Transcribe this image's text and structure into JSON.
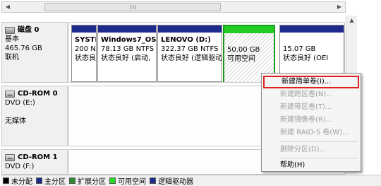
{
  "disks": [
    {
      "name": "磁盘 0",
      "type": "基本",
      "size": "465.76 GB",
      "status": "联机",
      "partitions": [
        {
          "title": "SYSTI",
          "size": "200 N",
          "status": "状态良好"
        },
        {
          "title": "Windows7_OS",
          "size": "78.13 GB NTFS",
          "status": "状态良好 (启动,"
        },
        {
          "title": "LENOVO  (D:)",
          "size": "322.37 GB NTFS",
          "status": "状态良好 (逻辑驱动"
        },
        {
          "title": "",
          "size": "50.00 GB",
          "status": "可用空间"
        },
        {
          "title": "",
          "size": "15.07 GB",
          "status": "状态良好 (OEI"
        }
      ]
    },
    {
      "name": "CD-ROM 0",
      "type": "DVD (E:)",
      "status": "无媒体"
    },
    {
      "name": "CD-ROM 1",
      "type": "DVD (F:)"
    }
  ],
  "legend": [
    {
      "label": "未分配",
      "color": "#000000"
    },
    {
      "label": "主分区",
      "color": "#1f2a8e"
    },
    {
      "label": "扩展分区",
      "color": "#2e8b2e"
    },
    {
      "label": "可用空间",
      "color": "#22dd22"
    },
    {
      "label": "逻辑驱动器",
      "color": "#1f2a8e"
    }
  ],
  "context_menu": {
    "items": [
      {
        "label": "新建简单卷(I)...",
        "enabled": true,
        "highlighted": true
      },
      {
        "label": "新建跨区卷(N)...",
        "enabled": false
      },
      {
        "label": "新建带区卷(T)...",
        "enabled": false
      },
      {
        "label": "新建镜像卷(R)...",
        "enabled": false
      },
      {
        "label": "新建 RAID-5 卷(W)...",
        "enabled": false
      },
      {
        "label": "删除分区(D)...",
        "enabled": false
      },
      {
        "label": "帮助(H)",
        "enabled": true
      }
    ]
  }
}
